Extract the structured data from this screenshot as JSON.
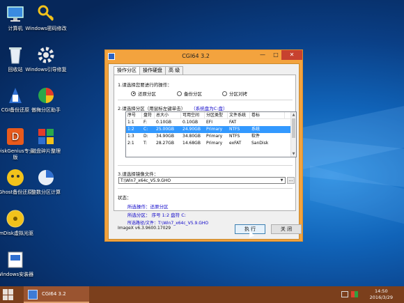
{
  "desktop": {
    "icons": [
      {
        "label": "计算机",
        "icon": "computer-icon"
      },
      {
        "label": "Windows密码修改",
        "icon": "key-icon"
      },
      {
        "label": "回收站",
        "icon": "recycle-bin-icon"
      },
      {
        "label": "Windows引导修复",
        "icon": "gear-icon"
      },
      {
        "label": "CGI备份还原",
        "icon": "backup-tool-icon"
      },
      {
        "label": "傲梅分区助手",
        "icon": "partition-assistant-icon"
      },
      {
        "label": "DiskGenius专业版",
        "icon": "diskgenius-icon"
      },
      {
        "label": "磁盘碎片整理",
        "icon": "defrag-icon"
      },
      {
        "label": "Ghost备份还原",
        "icon": "ghost-icon"
      },
      {
        "label": "整数分区计算",
        "icon": "partition-calc-icon"
      },
      {
        "label": "ImDisk虚拟光驱",
        "icon": "virtual-drive-icon"
      },
      {
        "label": "Windows安装器",
        "icon": "installer-icon"
      }
    ]
  },
  "window": {
    "title": "CGI64  3.2",
    "controls": {
      "minimize": "—",
      "maximize": "□",
      "close": "✕"
    },
    "tabs": [
      {
        "label": "操作分区",
        "active": true
      },
      {
        "label": "操作硬盘",
        "active": false
      },
      {
        "label": "高 级",
        "active": false
      }
    ],
    "step1": {
      "label": "1.请选择您要进行的操作：",
      "options": [
        {
          "label": "还原分区",
          "selected": true
        },
        {
          "label": "备份分区",
          "selected": false
        },
        {
          "label": "分区对拷",
          "selected": false
        }
      ]
    },
    "step2": {
      "label": "2.请选择分区（用鼠标左键单击）",
      "system_disk": "（系统盘为C:盘）",
      "columns": [
        "序号",
        "盘符",
        "总大小",
        "可用空间",
        "分区类型",
        "文件系统",
        "卷标"
      ],
      "rows": [
        {
          "cells": [
            "1:1",
            "F:",
            "0.10GB",
            "0.10GB",
            "EFI",
            "FAT",
            ""
          ],
          "selected": false
        },
        {
          "cells": [
            "1:2",
            "C:",
            "25.00GB",
            "24.90GB",
            "Primary",
            "NTFS",
            "系统"
          ],
          "selected": true
        },
        {
          "cells": [
            "1:3",
            "D:",
            "34.90GB",
            "34.80GB",
            "Primary",
            "NTFS",
            "软件"
          ],
          "selected": false
        },
        {
          "cells": [
            "2:1",
            "T:",
            "28.27GB",
            "14.68GB",
            "Primary",
            "exFAT",
            "SanDisk"
          ],
          "selected": false
        }
      ]
    },
    "step3": {
      "label": "3.请选择镜像文件：",
      "value": "T:\\Win7_x64c_V5.9.GHO",
      "browse_label": "..."
    },
    "status": {
      "label": "状态：",
      "operation": "所选操作：还原分区",
      "partition": "所选分区： 序号 1:2       盘符 C:",
      "path": "所选路径/文件：T:\\Win7_x64c_V5.9.GHO"
    },
    "version": "ImageX v6.3.9600.17029",
    "buttons": {
      "execute": "执 行",
      "close": "关 闭"
    }
  },
  "taskbar": {
    "task_label": "CGI64  3.2",
    "time": "14:50",
    "date": "2016/3/29"
  },
  "colors": {
    "window_frame": "#f3a33e",
    "selection": "#3399ff",
    "status_text": "#0a00c8",
    "taskbar": "#7b3f1c"
  }
}
